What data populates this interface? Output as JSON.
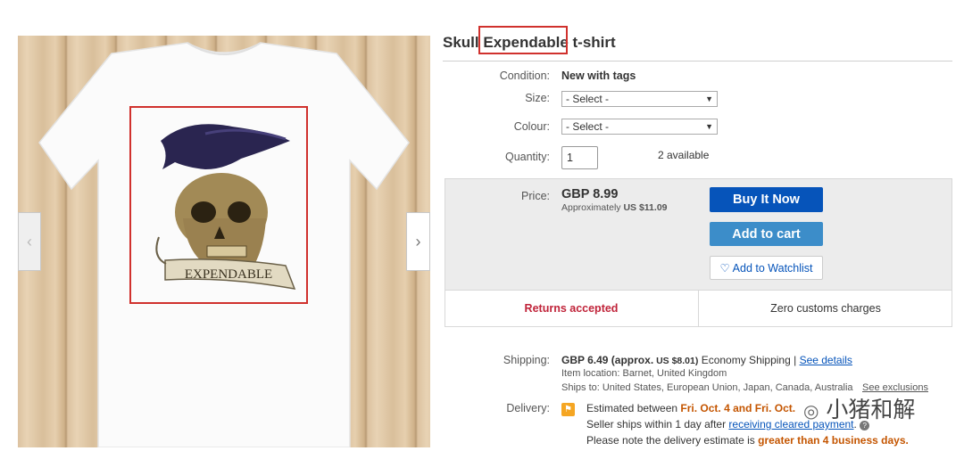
{
  "title": {
    "prefix": "Skull ",
    "highlight": "Expendable",
    "suffix": " t-shirt"
  },
  "gallery": {
    "prev_icon": "chevron-left-icon",
    "next_icon": "chevron-right-icon",
    "prev_glyph": "‹",
    "next_glyph": "›",
    "image_text": "EXPENDABLE"
  },
  "condition": {
    "label": "Condition:",
    "value": "New with tags"
  },
  "size": {
    "label": "Size:",
    "value": "- Select -"
  },
  "colour": {
    "label": "Colour:",
    "value": "- Select -"
  },
  "quantity": {
    "label": "Quantity:",
    "value": "1",
    "available": "2 available"
  },
  "price": {
    "label": "Price:",
    "value": "GBP 8.99",
    "approx_prefix": "Approximately ",
    "approx_value": "US $11.09"
  },
  "buttons": {
    "buy_now": "Buy It Now",
    "add_to_cart": "Add to cart",
    "watchlist": "Add to Watchlist",
    "watchlist_icon": "heart-icon"
  },
  "policies": {
    "returns": "Returns accepted",
    "customs": "Zero customs charges"
  },
  "shipping": {
    "label": "Shipping:",
    "value": "GBP 6.49 (approx.",
    "approx": " US $8.01)",
    "method": "Economy Shipping",
    "sep": " | ",
    "details_link": "See details",
    "location": "Item location:  Barnet, United Kingdom",
    "ships_to": "Ships to:  United States, European Union, Japan, Canada, Australia",
    "exclusions_link": "See exclusions"
  },
  "delivery": {
    "label": "Delivery:",
    "estimated_prefix": "Estimated between ",
    "estimated_dates": "Fri. Oct. 4 and Fri. Oct.",
    "seller_ships_prefix": "Seller ships within 1 day after ",
    "payment_link": "receiving cleared payment",
    "seller_ships_suffix": ".",
    "note_prefix": "Please note the delivery estimate is ",
    "note_highlight": "greater than 4 business days."
  },
  "watermark": "小猪和解",
  "colors": {
    "primary": "#0654ba",
    "cart": "#3c8dc9",
    "returns": "#c0243a",
    "orange": "#c45500",
    "highlight_box": "#d0312d"
  }
}
